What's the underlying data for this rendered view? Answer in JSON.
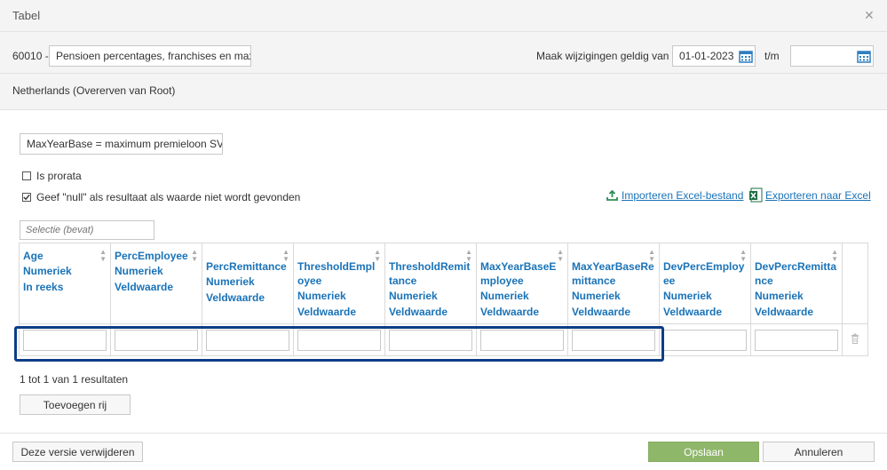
{
  "dialog": {
    "title": "Tabel"
  },
  "topbar": {
    "code_label": "60010 -",
    "name_value": "Pensioen percentages, franchises en max",
    "valid_from_label": "Maak wijzigingen geldig van",
    "valid_from_value": "01-01-2023",
    "to_label": "t/m",
    "to_value": ""
  },
  "subbar": {
    "country": "Netherlands (Overerven van Root)"
  },
  "content": {
    "description": "MaxYearBase = maximum premieloon SV",
    "prorata_label": "Is prorata",
    "null_label": "Geef \"null\" als resultaat als waarde niet wordt gevonden",
    "import_label": "Importeren Excel-bestand",
    "export_label": "Exporteren naar Excel",
    "filter_placeholder": "Selectie (bevat)"
  },
  "columns": [
    {
      "name": "Age",
      "type": "Numeriek",
      "kind": "In reeks"
    },
    {
      "name": "PercEmployee",
      "type": "Numeriek",
      "kind": "Veldwaarde"
    },
    {
      "name": "PercRemittance",
      "type": "Numeriek",
      "kind": "Veldwaarde"
    },
    {
      "name": "ThresholdEmployee",
      "type": "Numeriek",
      "kind": "Veldwaarde"
    },
    {
      "name": "ThresholdRemittance",
      "type": "Numeriek",
      "kind": "Veldwaarde"
    },
    {
      "name": "MaxYearBaseEmployee",
      "type": "Numeriek",
      "kind": "Veldwaarde"
    },
    {
      "name": "MaxYearBaseRemittance",
      "type": "Numeriek",
      "kind": "Veldwaarde"
    },
    {
      "name": "DevPercEmployee",
      "type": "Numeriek",
      "kind": "Veldwaarde"
    },
    {
      "name": "DevPercRemittance",
      "type": "Numeriek",
      "kind": "Veldwaarde"
    }
  ],
  "results_text": "1 tot 1 van 1 resultaten",
  "buttons": {
    "add_row": "Toevoegen rij",
    "delete_version": "Deze versie verwijderen",
    "save": "Opslaan",
    "cancel": "Annuleren"
  },
  "colors": {
    "link": "#1a73b8",
    "primary": "#8fb76a",
    "highlight": "#0d3d86"
  }
}
